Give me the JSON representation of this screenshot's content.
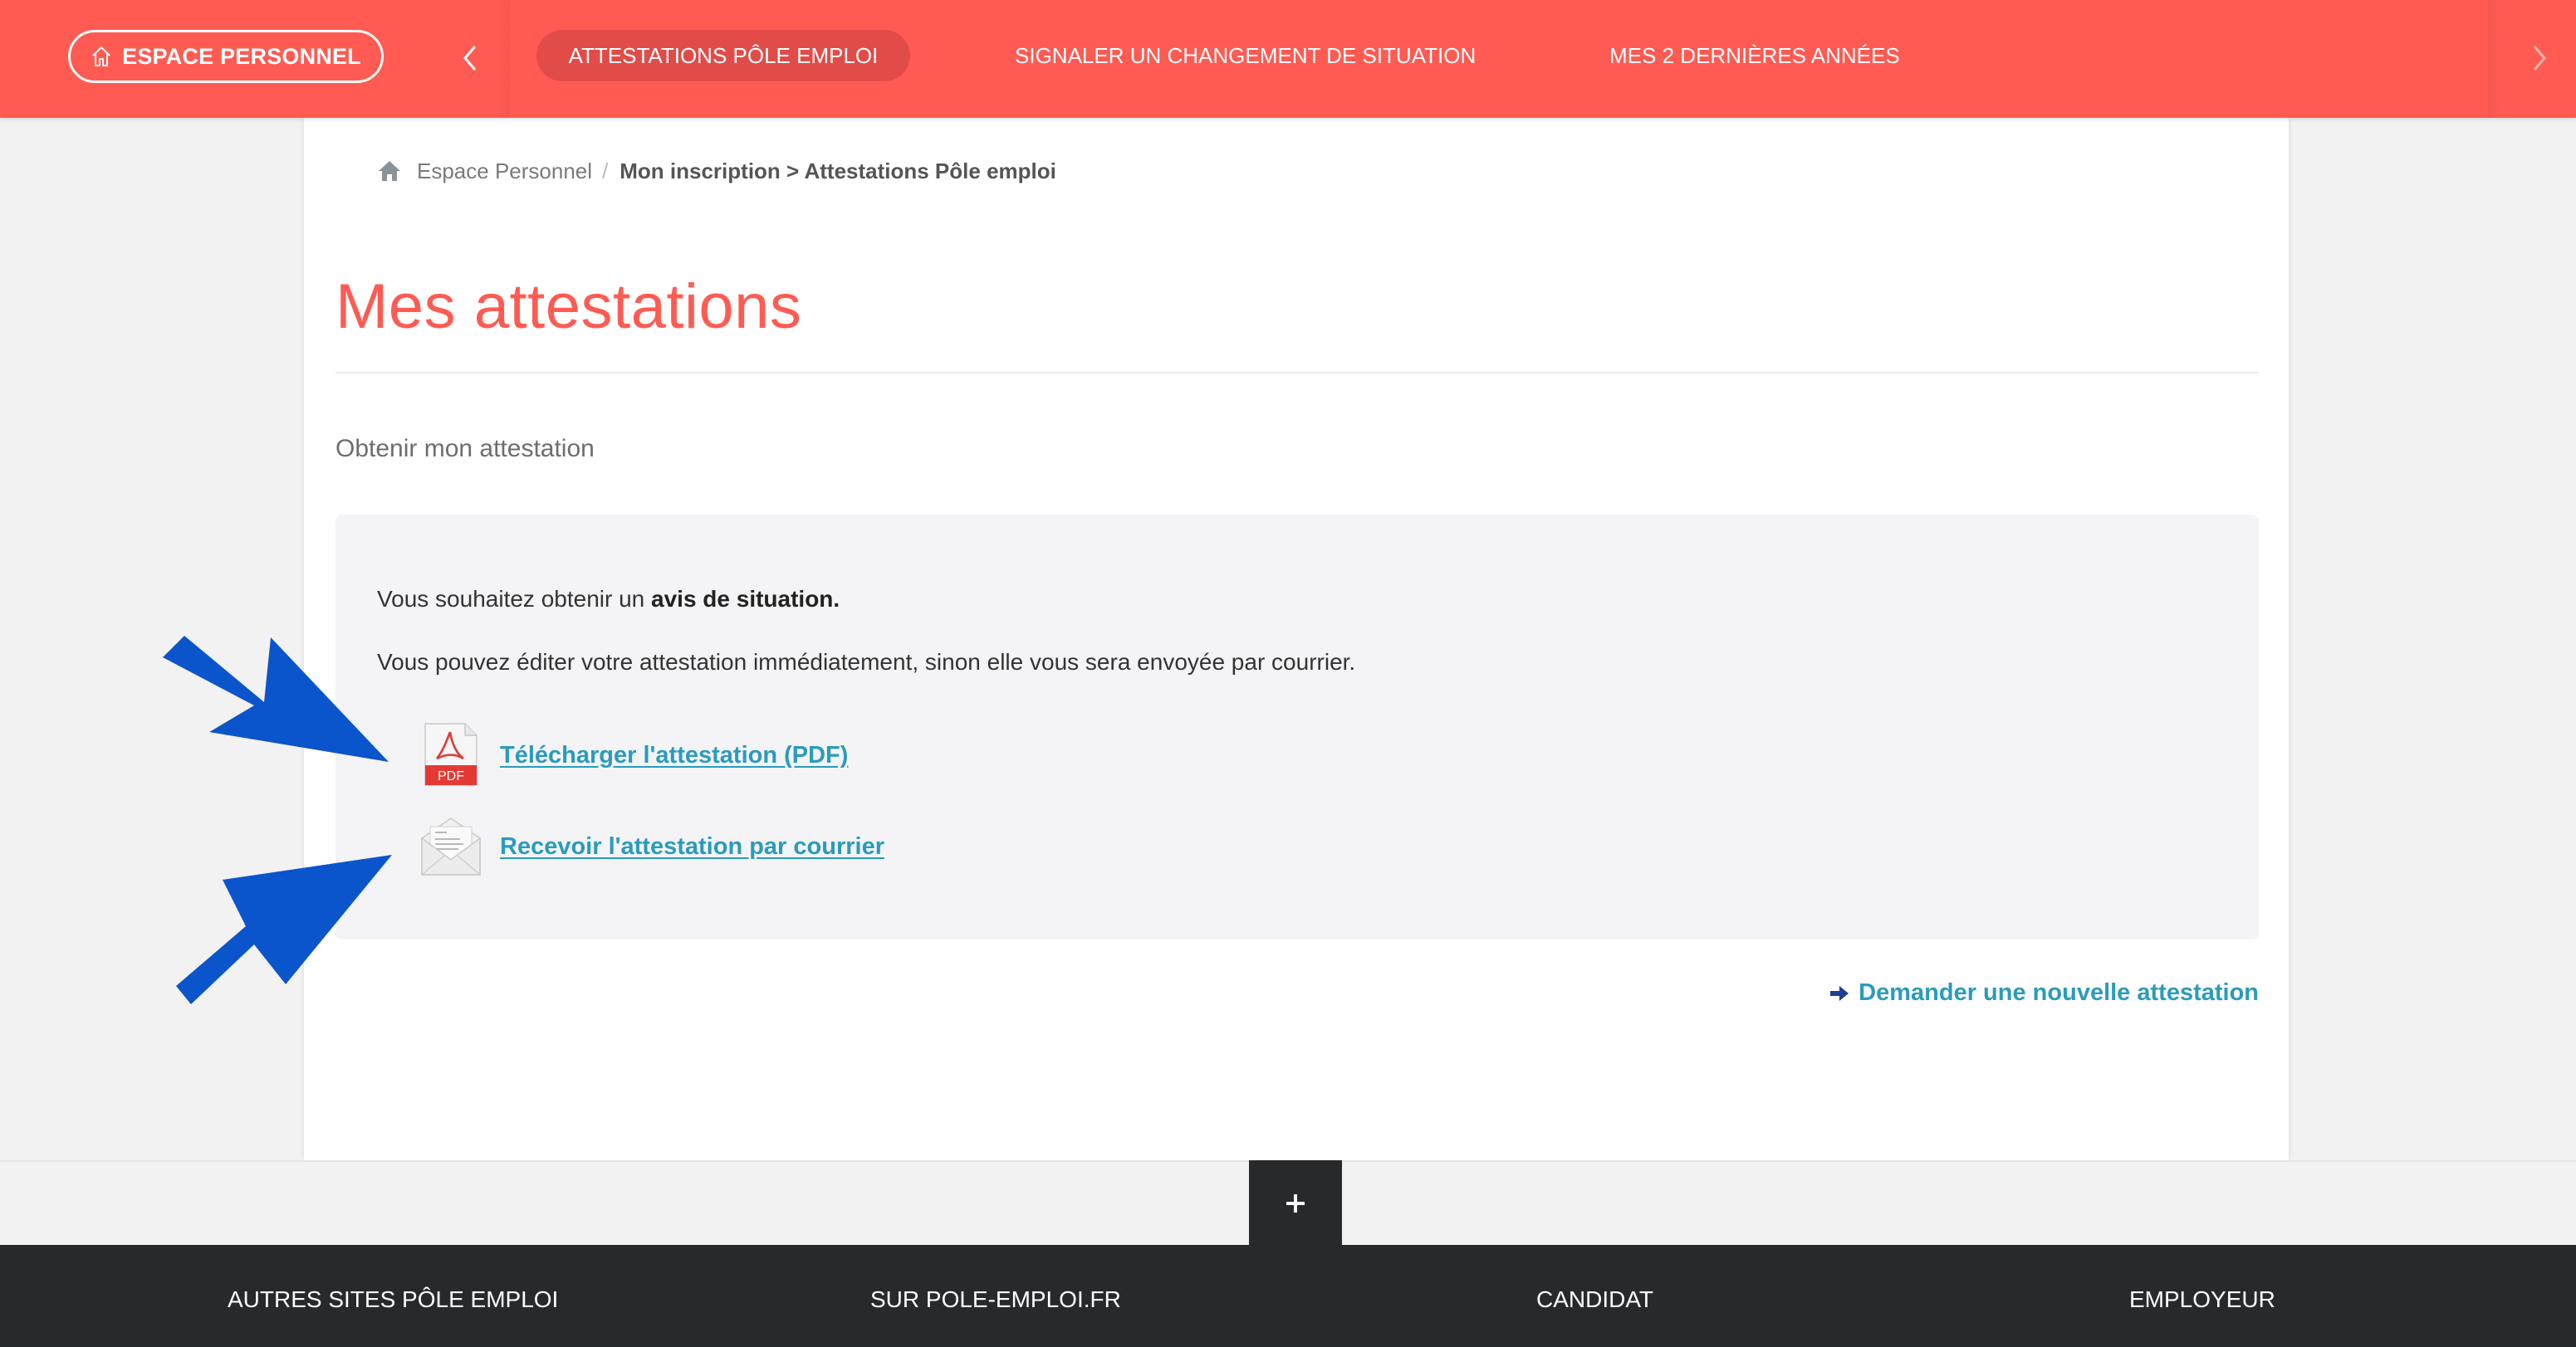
{
  "topnav": {
    "home_button": "ESPACE PERSONNEL",
    "tabs": [
      {
        "label": "ATTESTATIONS PÔLE EMPLOI",
        "active": true
      },
      {
        "label": "SIGNALER UN CHANGEMENT DE SITUATION",
        "active": false
      },
      {
        "label": "MES 2 DERNIÈRES ANNÉES",
        "active": false
      }
    ],
    "icons": {
      "home": "home-outline-icon",
      "prev": "chevron-left-icon",
      "next": "chevron-right-icon"
    }
  },
  "breadcrumb": {
    "home_icon": "home-icon",
    "root": "Espace Personnel",
    "separator": "/",
    "current": "Mon inscription > Attestations Pôle emploi"
  },
  "main": {
    "title": "Mes attestations",
    "subtitle": "Obtenir mon attestation",
    "info": {
      "line1_prefix": "Vous souhaitez obtenir un ",
      "line1_bold": "avis de situation.",
      "line2": "Vous pouvez éditer votre attestation immédiatement, sinon elle vous sera envoyée par courrier."
    },
    "actions": [
      {
        "label": "Télécharger l'attestation (PDF)",
        "icon": "pdf-file-icon",
        "icon_text": "PDF"
      },
      {
        "label": "Recevoir l'attestation par courrier",
        "icon": "mail-envelope-icon"
      }
    ],
    "new_request_link": "Demander une nouvelle attestation",
    "new_request_icon": "arrow-right-icon"
  },
  "footer": {
    "expand_icon": "plus-icon",
    "items": [
      "AUTRES SITES PÔLE EMPLOI",
      "SUR POLE-EMPLOI.FR",
      "CANDIDAT",
      "EMPLOYEUR"
    ]
  },
  "annotations": {
    "arrows": 2,
    "color": "#0a55cc"
  },
  "colors": {
    "brand_red": "#ff5b53",
    "active_tab": "#e14c48",
    "link": "#2a9bbd",
    "footer_bg": "#28292b"
  }
}
